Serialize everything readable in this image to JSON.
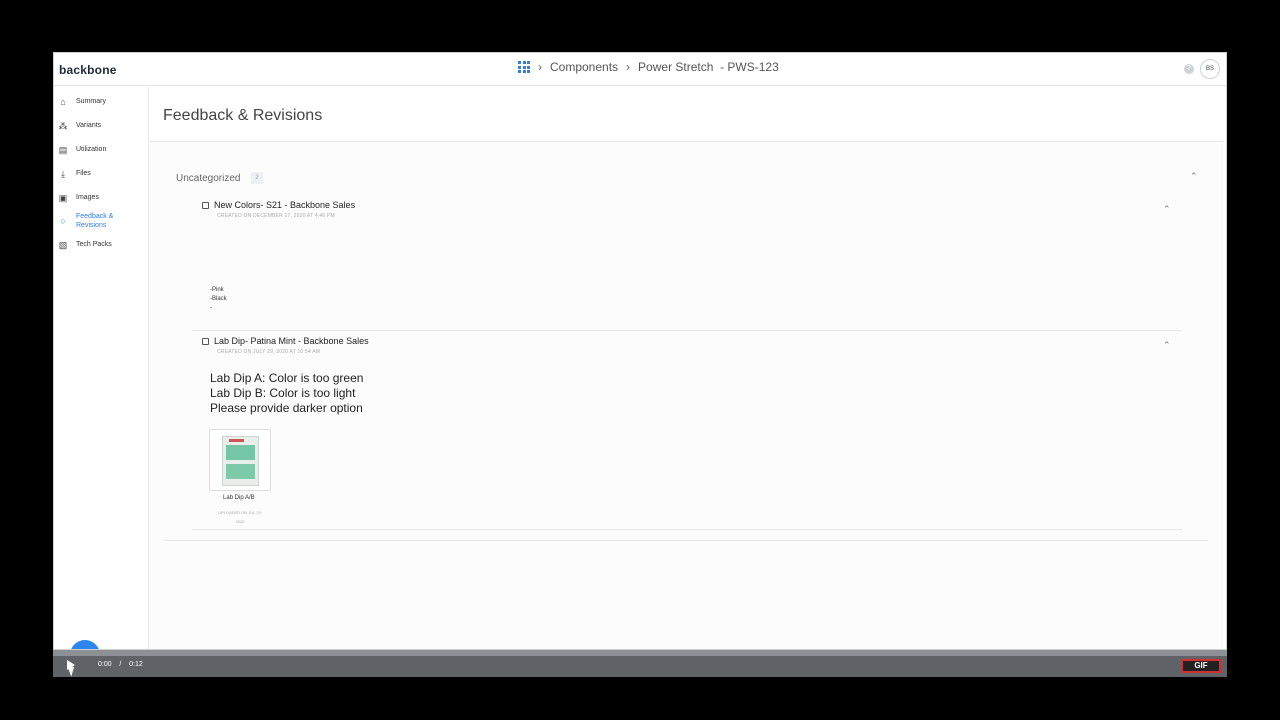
{
  "app": {
    "logo": "backbone"
  },
  "header": {
    "breadcrumb": [
      "Components",
      "Power Stretch  - PWS-123"
    ],
    "help_label": "?",
    "avatar_initials": "BS"
  },
  "sidebar": {
    "items": [
      {
        "label": "Summary",
        "icon": "home-icon"
      },
      {
        "label": "Variants",
        "icon": "variants-icon"
      },
      {
        "label": "Utilization",
        "icon": "utilization-icon"
      },
      {
        "label": "Files",
        "icon": "download-icon"
      },
      {
        "label": "Images",
        "icon": "image-icon"
      },
      {
        "label": "Feedback & Revisions",
        "icon": "chat-icon",
        "active": true
      },
      {
        "label": "Tech Packs",
        "icon": "document-icon"
      }
    ]
  },
  "main": {
    "title": "Feedback & Revisions",
    "section": {
      "label": "Uncategorized",
      "count": "2"
    },
    "items": [
      {
        "title": "New Colors- S21 - Backbone Sales",
        "created": "CREATED ON DECEMBER 17, 2020 AT 4:46 PM",
        "lines": [
          "-Pink",
          "-Black",
          "-"
        ]
      },
      {
        "title": "Lab Dip- Patina Mint - Backbone Sales",
        "created": "CREATED ON JULY 29, 2020 AT 10:54 AM",
        "lines": [
          "Lab Dip A: Color is too green",
          "Lab Dip B: Color is too light",
          "Please provide darker option"
        ],
        "attachment": {
          "label": "Lab Dip A/B",
          "uploaded_1": "UPLOADED ON JUL 29,",
          "uploaded_2": "2020"
        }
      }
    ]
  },
  "fab": {
    "add_label": "+"
  },
  "player": {
    "current": "0:00",
    "separator": "/",
    "duration": "0:12",
    "gif_label": "GIF"
  },
  "colors": {
    "accent": "#2d86f0",
    "player_bg": "#5f6368",
    "gif_border": "#d32f2f"
  }
}
